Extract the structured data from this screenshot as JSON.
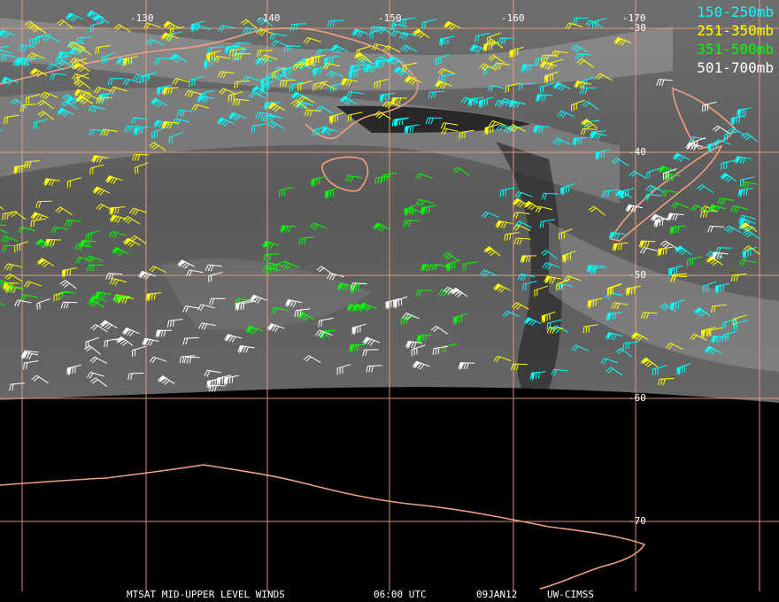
{
  "legend": [
    {
      "label": "150-250mb",
      "color": "#00ffff"
    },
    {
      "label": "251-350mb",
      "color": "#ffff00"
    },
    {
      "label": "351-500mb",
      "color": "#00ff00"
    },
    {
      "label": "501-700mb",
      "color": "#ffffff"
    }
  ],
  "grid": {
    "longitude_labels": [
      "-130",
      "-140",
      "-150",
      "-160",
      "-170"
    ],
    "latitude_labels": [
      "-30",
      "-40",
      "-50",
      "-60",
      "-70"
    ],
    "line_color": "#f0a080"
  },
  "footer": {
    "product": "MTSAT MID-UPPER LEVEL WINDS",
    "time": "06:00 UTC",
    "date": "09JAN12",
    "source": "UW-CIMSS"
  },
  "colors": {
    "coastline": "#f0a080",
    "background": "#000000",
    "imagery": "#5a5a5a"
  }
}
